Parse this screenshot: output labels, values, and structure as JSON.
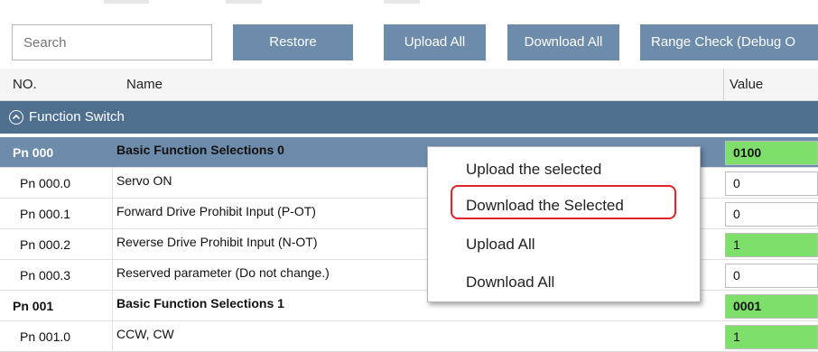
{
  "toolbar": {
    "search_placeholder": "Search",
    "restore_label": "Restore",
    "upload_all_label": "Upload All",
    "download_all_label": "Download All",
    "range_check_label": "Range Check (Debug O"
  },
  "table": {
    "headers": {
      "no": "NO.",
      "name": "Name",
      "value": "Value"
    },
    "group": "Function Switch",
    "rows": [
      {
        "no": "Pn 000",
        "name": "Basic Function Selections 0",
        "value": "0100"
      },
      {
        "no": "Pn 000.0",
        "name": "Servo ON",
        "value": "0"
      },
      {
        "no": "Pn 000.1",
        "name": "Forward Drive Prohibit Input (P-OT)",
        "value": "0"
      },
      {
        "no": "Pn 000.2",
        "name": "Reverse Drive Prohibit Input (N-OT)",
        "value": "1"
      },
      {
        "no": "Pn 000.3",
        "name": "Reserved parameter (Do not change.)",
        "value": "0"
      },
      {
        "no": "Pn 001",
        "name": "Basic Function Selections 1",
        "value": "0001"
      },
      {
        "no": "Pn 001.0",
        "name": "CCW, CW",
        "value": "1"
      }
    ]
  },
  "context_menu": {
    "items": [
      "Upload the selected",
      "Download the Selected",
      "Upload All",
      "Download All"
    ]
  },
  "colors": {
    "accent": "#6d8bab",
    "group_header": "#4f6f8f",
    "value_green": "#7ee06b",
    "highlight_red": "#e0222a"
  }
}
